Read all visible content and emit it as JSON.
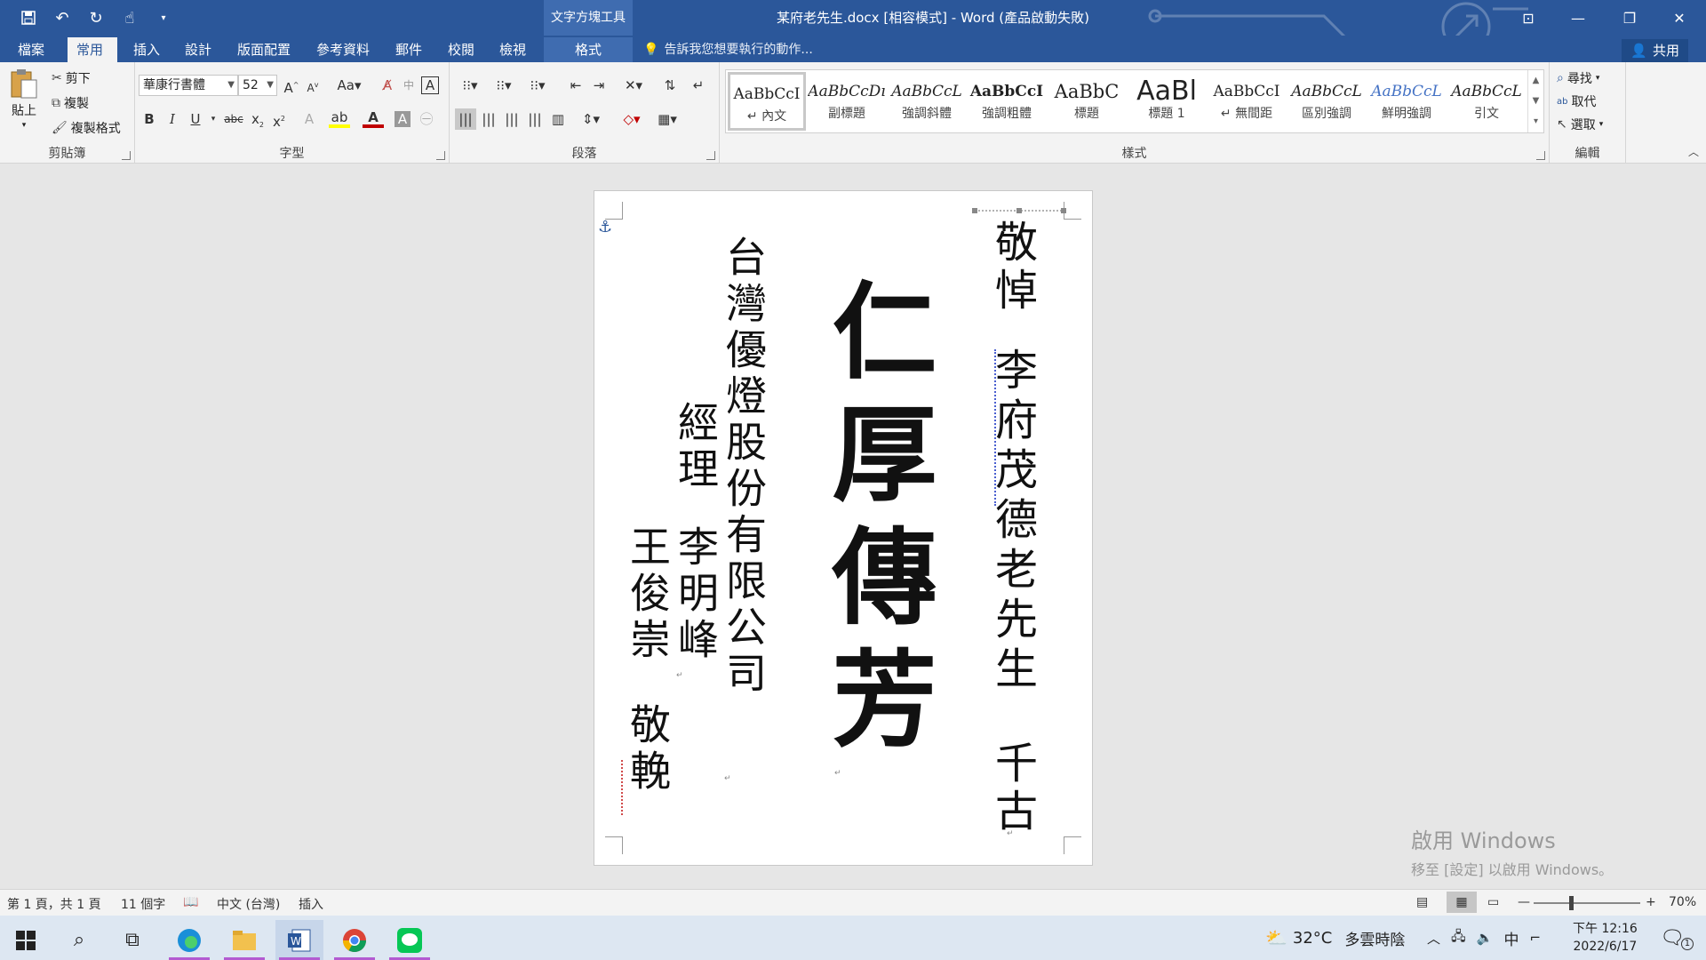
{
  "titlebar": {
    "context_tool": "文字方塊工具",
    "doc_title": "某府老先生.docx [相容模式] - Word (產品啟動失敗)",
    "icons": [
      "save-icon",
      "undo-icon",
      "redo-icon",
      "touch-mode-icon",
      "customize-icon"
    ]
  },
  "tabs": {
    "file": "檔案",
    "home": "常用",
    "insert": "插入",
    "design": "設計",
    "layout": "版面配置",
    "references": "參考資料",
    "mailings": "郵件",
    "review": "校閱",
    "view": "檢視",
    "format": "格式",
    "tellme": "告訴我您想要執行的動作...",
    "share": "共用"
  },
  "clipboard": {
    "paste": "貼上",
    "cut": "剪下",
    "copy": "複製",
    "format_painter": "複製格式",
    "label": "剪貼簿"
  },
  "font": {
    "name": "華康行書體",
    "size": "52",
    "label": "字型"
  },
  "paragraph": {
    "label": "段落"
  },
  "styles": {
    "label": "樣式",
    "items": [
      {
        "sample": "AaBbCcI",
        "name": "↵ 內文"
      },
      {
        "sample": "AaBbCcDı",
        "name": "副標題"
      },
      {
        "sample": "AaBbCcL",
        "name": "強調斜體"
      },
      {
        "sample": "AaBbCcI",
        "name": "強調粗體"
      },
      {
        "sample": "AaBbC",
        "name": "標題"
      },
      {
        "sample": "AaBl",
        "name": "標題 1"
      },
      {
        "sample": "AaBbCcI",
        "name": "↵ 無間距"
      },
      {
        "sample": "AaBbCcL",
        "name": "區別強調"
      },
      {
        "sample": "AaBbCcL",
        "name": "鮮明強調"
      },
      {
        "sample": "AaBbCcL",
        "name": "引文"
      }
    ]
  },
  "editing": {
    "find": "尋找",
    "replace": "取代",
    "select": "選取",
    "label": "編輯"
  },
  "document": {
    "col_mourn": "敬悼",
    "col_deceased": "李府茂德老先生",
    "col_forever": "千古",
    "col_main": "仁厚傳芳",
    "col_company": "台灣優燈股份有限公司",
    "col_manager_title": "經理",
    "col_name1": "李明峰",
    "col_name2": "王俊崇",
    "col_presented": "敬輓"
  },
  "watermark": {
    "line1": "啟用 Windows",
    "line2": "移至 [設定] 以啟用 Windows。"
  },
  "status": {
    "page": "第 1 頁，共 1 頁",
    "words": "11 個字",
    "language": "中文 (台灣)",
    "mode": "插入",
    "zoom": "70%"
  },
  "taskbar": {
    "temperature": "32°C",
    "weather": "多雲時陰",
    "ime": "中",
    "time": "下午 12:16",
    "date": "2022/6/17",
    "notifications": "1"
  },
  "colors": {
    "accent": "#2b579a",
    "ribbon": "#f3f3f3",
    "doc_bg": "#e6e6e6"
  }
}
